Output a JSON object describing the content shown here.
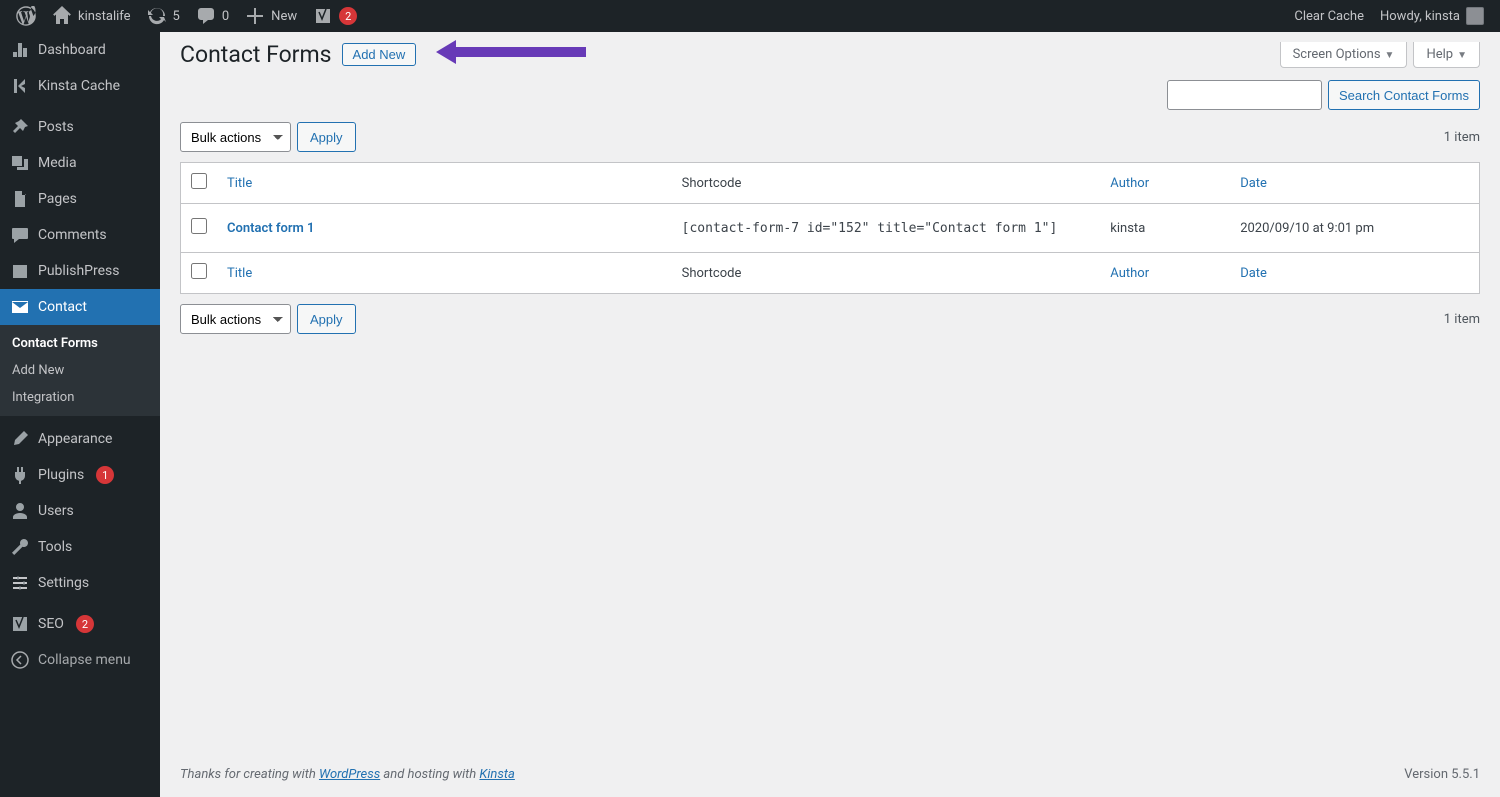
{
  "toolbar": {
    "site_name": "kinstalife",
    "updates_count": "5",
    "comments_count": "0",
    "new_label": "New",
    "notif_count": "2",
    "clear_cache": "Clear Cache",
    "howdy": "Howdy, kinsta"
  },
  "sidebar": {
    "dashboard": "Dashboard",
    "kinsta_cache": "Kinsta Cache",
    "posts": "Posts",
    "media": "Media",
    "pages": "Pages",
    "comments": "Comments",
    "publishpress": "PublishPress",
    "contact": "Contact",
    "contact_forms": "Contact Forms",
    "add_new": "Add New",
    "integration": "Integration",
    "appearance": "Appearance",
    "plugins": "Plugins",
    "plugins_count": "1",
    "users": "Users",
    "tools": "Tools",
    "settings": "Settings",
    "seo": "SEO",
    "seo_count": "2",
    "collapse": "Collapse menu"
  },
  "screen_meta": {
    "screen_options": "Screen Options",
    "help": "Help"
  },
  "page": {
    "heading": "Contact Forms",
    "add_new_btn": "Add New",
    "search_btn": "Search Contact Forms",
    "bulk_actions": "Bulk actions",
    "apply": "Apply",
    "item_count": "1 item"
  },
  "table": {
    "col_title": "Title",
    "col_shortcode": "Shortcode",
    "col_author": "Author",
    "col_date": "Date",
    "rows": [
      {
        "title": "Contact form 1",
        "shortcode": "[contact-form-7 id=\"152\" title=\"Contact form 1\"]",
        "author": "kinsta",
        "date": "2020/09/10 at 9:01 pm"
      }
    ]
  },
  "footer": {
    "thanks_prefix": "Thanks for creating with ",
    "wordpress": "WordPress",
    "hosting_mid": " and hosting with ",
    "kinsta": "Kinsta",
    "version": "Version 5.5.1"
  }
}
